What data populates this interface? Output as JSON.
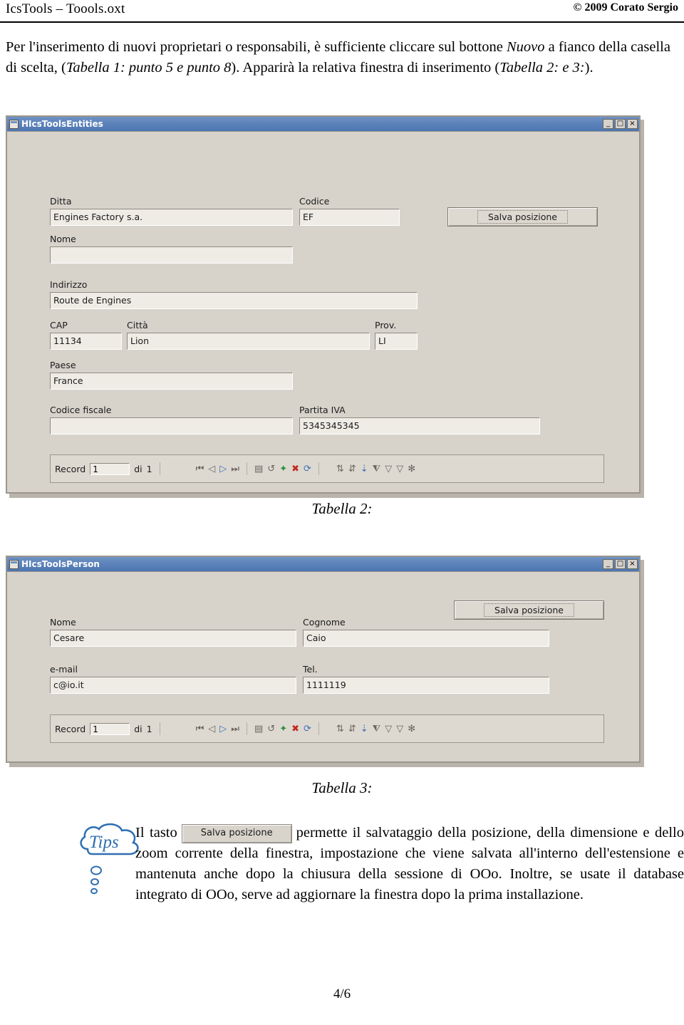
{
  "header": {
    "left": "IcsTools – Toools.oxt",
    "right": "© 2009 Corato Sergio"
  },
  "intro": {
    "line1_a": "Per l'inserimento di nuovi proprietari o responsabili, è sufficiente cliccare sul bottone ",
    "line1_i": "Nuovo",
    "line1_b": " a",
    "line2_a": "fianco della casella di scelta, (",
    "line2_i": "Tabella 1: punto 5 e punto 8",
    "line2_b": "). Apparirà la relativa finestra di",
    "line3_a": "inserimento (",
    "line3_i": "Tabella 2: e 3:",
    "line3_b": ")."
  },
  "window1": {
    "title": "HIcsToolsEntities",
    "minimize": "_",
    "maximize": "□",
    "close": "×",
    "labels": {
      "ditta": "Ditta",
      "codice": "Codice",
      "nome": "Nome",
      "indirizzo": "Indirizzo",
      "cap": "CAP",
      "citta": "Città",
      "prov": "Prov.",
      "paese": "Paese",
      "codice_fiscale": "Codice fiscale",
      "partita_iva": "Partita IVA"
    },
    "values": {
      "ditta": "Engines Factory s.a.",
      "codice": "EF",
      "nome": "",
      "indirizzo": "Route de Engines",
      "cap": "11134",
      "citta": "Lion",
      "prov": "LI",
      "paese": "France",
      "codice_fiscale": "",
      "partita_iva": "5345345345"
    },
    "save_button": "Salva posizione",
    "nav": {
      "record_label": "Record",
      "record_value": "1",
      "of_label": "di",
      "total": "1"
    }
  },
  "caption1": "Tabella 2:",
  "window2": {
    "title": "HIcsToolsPerson",
    "minimize": "_",
    "maximize": "□",
    "close": "×",
    "labels": {
      "nome": "Nome",
      "cognome": "Cognome",
      "email": "e-mail",
      "tel": "Tel."
    },
    "values": {
      "nome": "Cesare",
      "cognome": "Caio",
      "email": "c@io.it",
      "tel": "1111119"
    },
    "save_button": "Salva posizione",
    "nav": {
      "record_label": "Record",
      "record_value": "1",
      "of_label": "di",
      "total": "1"
    }
  },
  "caption2": "Tabella 3:",
  "tips": {
    "cloud_label": "Tips",
    "text_a": "Il tasto",
    "button_label": "Salva posizione",
    "text_b": "permette il salvataggio della posizione, della dimensione e dello zoom corrente della finestra,  impostazione che viene salvata all'interno dell'estensione e mantenuta anche dopo la chiusura della sessione di OOo. Inoltre, se usate il database integrato di OOo, serve ad aggiornare la finestra dopo la prima installazione."
  },
  "footer": {
    "page": "4/6"
  },
  "colors": {
    "titlebar": "#5d83ba",
    "window_face": "#d7d3cb",
    "field_face": "#efece6"
  }
}
